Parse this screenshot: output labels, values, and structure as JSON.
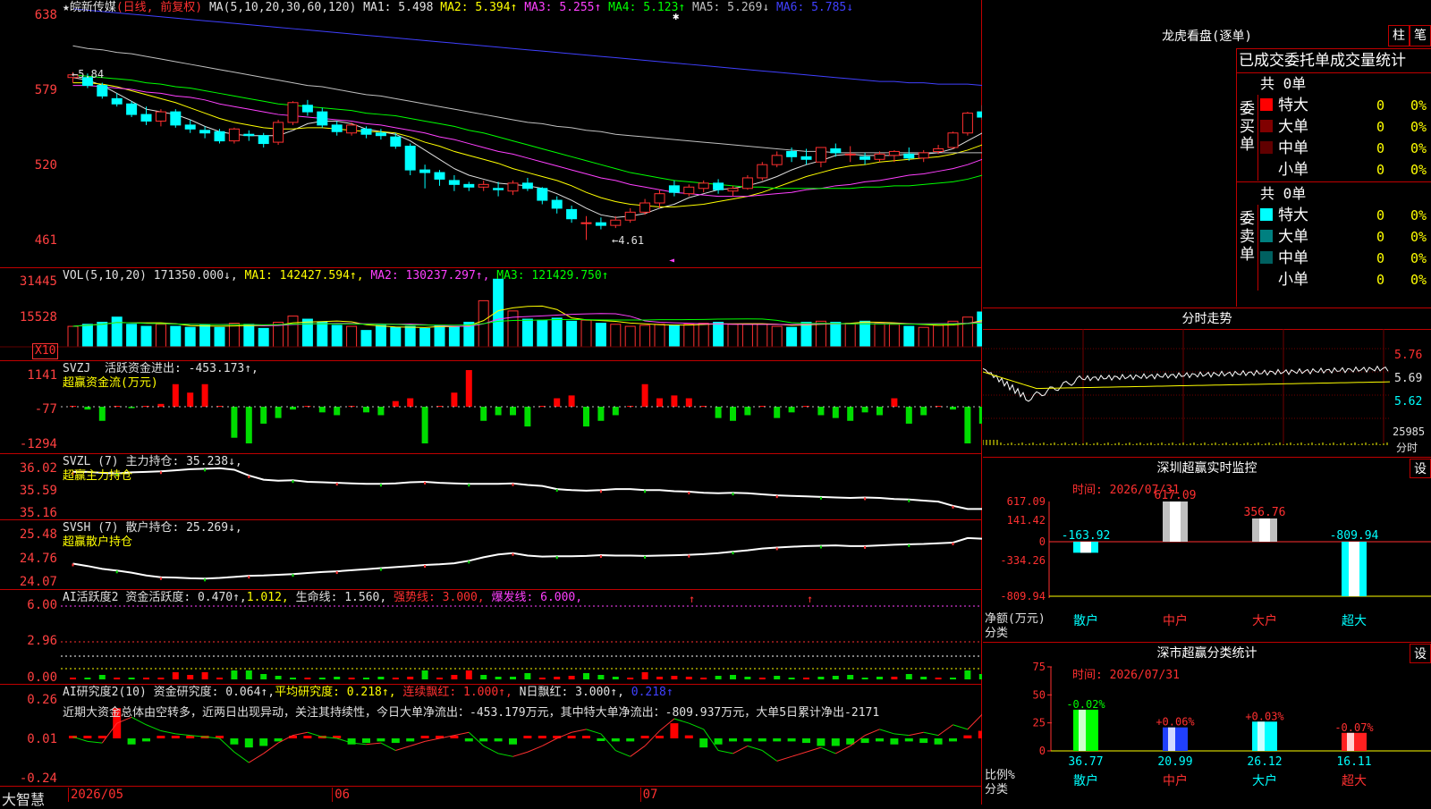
{
  "main": {
    "stock": "★皖新传媒",
    "period": "(日线, 前复权)",
    "ma_label": "MA(5,10,20,30,60,120)",
    "ma": [
      {
        "label": "MA1: 5.498",
        "color": "#e0e0e0"
      },
      {
        "label": "MA2: 5.394↑",
        "color": "#ffff00"
      },
      {
        "label": "MA3: 5.255↑",
        "color": "#ff40ff"
      },
      {
        "label": "MA4: 5.123↑",
        "color": "#00ff00"
      },
      {
        "label": "MA5: 5.269↓",
        "color": "#c0c0c0"
      },
      {
        "label": "MA6: 5.785↓",
        "color": "#4040ff"
      }
    ],
    "y_ticks": [
      "638",
      "579",
      "520",
      "461"
    ],
    "y_range": [
      4.45,
      6.4
    ],
    "high_label": "←5.84",
    "low_label": "←4.61",
    "candles": [
      [
        5.84,
        5.88,
        5.8,
        5.86
      ],
      [
        5.84,
        5.87,
        5.76,
        5.78
      ],
      [
        5.78,
        5.8,
        5.68,
        5.7
      ],
      [
        5.68,
        5.72,
        5.62,
        5.64
      ],
      [
        5.64,
        5.66,
        5.54,
        5.56
      ],
      [
        5.56,
        5.62,
        5.48,
        5.51
      ],
      [
        5.51,
        5.6,
        5.47,
        5.58
      ],
      [
        5.58,
        5.6,
        5.46,
        5.48
      ],
      [
        5.48,
        5.52,
        5.42,
        5.45
      ],
      [
        5.44,
        5.47,
        5.38,
        5.42
      ],
      [
        5.43,
        5.45,
        5.34,
        5.36
      ],
      [
        5.36,
        5.46,
        5.34,
        5.45
      ],
      [
        5.41,
        5.44,
        5.36,
        5.4
      ],
      [
        5.4,
        5.42,
        5.31,
        5.34
      ],
      [
        5.35,
        5.52,
        5.33,
        5.5
      ],
      [
        5.5,
        5.66,
        5.48,
        5.65
      ],
      [
        5.63,
        5.67,
        5.55,
        5.58
      ],
      [
        5.58,
        5.61,
        5.46,
        5.48
      ],
      [
        5.48,
        5.51,
        5.4,
        5.43
      ],
      [
        5.42,
        5.5,
        5.4,
        5.48
      ],
      [
        5.45,
        5.47,
        5.38,
        5.41
      ],
      [
        5.42,
        5.45,
        5.37,
        5.4
      ],
      [
        5.39,
        5.42,
        5.3,
        5.32
      ],
      [
        5.32,
        5.34,
        5.1,
        5.14
      ],
      [
        5.14,
        5.18,
        5.0,
        5.12
      ],
      [
        5.12,
        5.14,
        5.02,
        5.07
      ],
      [
        5.06,
        5.1,
        4.98,
        5.03
      ],
      [
        5.03,
        5.05,
        4.98,
        5.01
      ],
      [
        5.01,
        5.06,
        4.98,
        5.03
      ],
      [
        5.0,
        5.05,
        4.94,
        4.99
      ],
      [
        4.98,
        5.06,
        4.95,
        5.04
      ],
      [
        5.04,
        5.08,
        4.98,
        5.0
      ],
      [
        5.0,
        5.01,
        4.88,
        4.91
      ],
      [
        4.91,
        4.94,
        4.81,
        4.85
      ],
      [
        4.84,
        4.87,
        4.74,
        4.77
      ],
      [
        4.74,
        4.79,
        4.61,
        4.74
      ],
      [
        4.74,
        4.78,
        4.69,
        4.72
      ],
      [
        4.72,
        4.79,
        4.7,
        4.76
      ],
      [
        4.76,
        4.85,
        4.74,
        4.82
      ],
      [
        4.82,
        4.92,
        4.8,
        4.89
      ],
      [
        4.89,
        4.99,
        4.85,
        4.96
      ],
      [
        5.02,
        5.06,
        4.94,
        4.97
      ],
      [
        4.96,
        5.03,
        4.94,
        5.01
      ],
      [
        5.0,
        5.06,
        4.97,
        5.04
      ],
      [
        5.04,
        5.07,
        4.96,
        4.99
      ],
      [
        4.98,
        5.02,
        4.94,
        5.0
      ],
      [
        5.0,
        5.1,
        4.99,
        5.08
      ],
      [
        5.08,
        5.2,
        5.06,
        5.18
      ],
      [
        5.18,
        5.28,
        5.16,
        5.25
      ],
      [
        5.28,
        5.31,
        5.2,
        5.24
      ],
      [
        5.24,
        5.3,
        5.18,
        5.22
      ],
      [
        5.2,
        5.28,
        5.16,
        5.31
      ],
      [
        5.3,
        5.34,
        5.24,
        5.27
      ],
      [
        5.26,
        5.32,
        5.2,
        5.26
      ],
      [
        5.24,
        5.27,
        5.18,
        5.22
      ],
      [
        5.22,
        5.28,
        5.2,
        5.26
      ],
      [
        5.25,
        5.29,
        5.2,
        5.28
      ],
      [
        5.26,
        5.31,
        5.21,
        5.23
      ],
      [
        5.23,
        5.29,
        5.2,
        5.27
      ],
      [
        5.28,
        5.33,
        5.26,
        5.3
      ],
      [
        5.31,
        5.43,
        5.3,
        5.42
      ],
      [
        5.42,
        5.58,
        5.4,
        5.57
      ],
      [
        5.58,
        5.63,
        5.52,
        5.54
      ]
    ],
    "ma_lines": [
      {
        "color": "#e0e0e0",
        "v": [
          5.84,
          5.82,
          5.78,
          5.72,
          5.66,
          5.6,
          5.58,
          5.56,
          5.52,
          5.47,
          5.43,
          5.41,
          5.4,
          5.4,
          5.4,
          5.44,
          5.49,
          5.51,
          5.51,
          5.49,
          5.45,
          5.43,
          5.41,
          5.36,
          5.29,
          5.22,
          5.15,
          5.1,
          5.07,
          5.04,
          5.03,
          5.02,
          5.0,
          4.96,
          4.91,
          4.85,
          4.8,
          4.78,
          4.79,
          4.81,
          4.85,
          4.88,
          4.93,
          4.96,
          4.99,
          5.0,
          5.02,
          5.05,
          5.09,
          5.14,
          5.18,
          5.21,
          5.25,
          5.26,
          5.25,
          5.25,
          5.25,
          5.26,
          5.26,
          5.27,
          5.3,
          5.36,
          5.42
        ]
      },
      {
        "color": "#ffff00",
        "v": [
          5.8,
          5.8,
          5.79,
          5.77,
          5.74,
          5.71,
          5.68,
          5.65,
          5.61,
          5.57,
          5.53,
          5.5,
          5.48,
          5.46,
          5.45,
          5.45,
          5.46,
          5.46,
          5.45,
          5.44,
          5.43,
          5.43,
          5.42,
          5.39,
          5.35,
          5.32,
          5.28,
          5.25,
          5.22,
          5.19,
          5.15,
          5.12,
          5.09,
          5.06,
          5.02,
          4.97,
          4.93,
          4.9,
          4.88,
          4.87,
          4.86,
          4.86,
          4.87,
          4.88,
          4.9,
          4.92,
          4.94,
          4.97,
          5.01,
          5.05,
          5.09,
          5.12,
          5.15,
          5.17,
          5.18,
          5.2,
          5.21,
          5.22,
          5.23,
          5.24,
          5.26,
          5.29,
          5.33
        ]
      },
      {
        "color": "#ff40ff",
        "v": [
          5.78,
          5.78,
          5.77,
          5.76,
          5.75,
          5.73,
          5.72,
          5.7,
          5.69,
          5.67,
          5.64,
          5.62,
          5.6,
          5.58,
          5.56,
          5.55,
          5.54,
          5.53,
          5.52,
          5.51,
          5.49,
          5.48,
          5.46,
          5.44,
          5.42,
          5.39,
          5.37,
          5.34,
          5.31,
          5.28,
          5.26,
          5.23,
          5.2,
          5.17,
          5.14,
          5.11,
          5.08,
          5.06,
          5.03,
          5.01,
          4.99,
          4.97,
          4.96,
          4.95,
          4.94,
          4.94,
          4.94,
          4.95,
          4.96,
          4.97,
          4.99,
          5.0,
          5.02,
          5.03,
          5.05,
          5.06,
          5.08,
          5.1,
          5.11,
          5.13,
          5.15,
          5.18,
          5.22
        ]
      },
      {
        "color": "#00ff00",
        "v": [
          5.86,
          5.85,
          5.84,
          5.83,
          5.82,
          5.8,
          5.79,
          5.77,
          5.76,
          5.74,
          5.72,
          5.7,
          5.68,
          5.66,
          5.64,
          5.63,
          5.62,
          5.61,
          5.6,
          5.59,
          5.57,
          5.56,
          5.55,
          5.53,
          5.51,
          5.49,
          5.47,
          5.44,
          5.42,
          5.39,
          5.36,
          5.33,
          5.3,
          5.27,
          5.24,
          5.21,
          5.18,
          5.15,
          5.12,
          5.1,
          5.08,
          5.06,
          5.05,
          5.04,
          5.03,
          5.02,
          5.01,
          5.01,
          5.0,
          5.0,
          5.0,
          5.0,
          5.0,
          5.0,
          5.01,
          5.01,
          5.02,
          5.02,
          5.03,
          5.04,
          5.05,
          5.07,
          5.1
        ]
      },
      {
        "color": "#c0c0c0",
        "v": [
          6.08,
          6.06,
          6.05,
          6.03,
          6.02,
          6.0,
          5.98,
          5.96,
          5.94,
          5.92,
          5.9,
          5.88,
          5.86,
          5.84,
          5.82,
          5.8,
          5.78,
          5.77,
          5.75,
          5.73,
          5.71,
          5.7,
          5.68,
          5.66,
          5.64,
          5.62,
          5.6,
          5.58,
          5.56,
          5.54,
          5.52,
          5.5,
          5.49,
          5.47,
          5.46,
          5.44,
          5.43,
          5.41,
          5.4,
          5.39,
          5.38,
          5.37,
          5.36,
          5.35,
          5.34,
          5.33,
          5.32,
          5.31,
          5.3,
          5.29,
          5.28,
          5.28,
          5.27,
          5.27,
          5.27,
          5.27,
          5.27,
          5.27,
          5.27,
          5.27,
          5.27,
          5.27,
          5.27
        ]
      },
      {
        "color": "#4040ff",
        "v": [
          6.36,
          6.35,
          6.34,
          6.33,
          6.32,
          6.31,
          6.3,
          6.29,
          6.28,
          6.27,
          6.26,
          6.25,
          6.24,
          6.23,
          6.22,
          6.21,
          6.2,
          6.19,
          6.18,
          6.17,
          6.16,
          6.15,
          6.14,
          6.13,
          6.12,
          6.11,
          6.1,
          6.09,
          6.08,
          6.07,
          6.06,
          6.05,
          6.04,
          6.03,
          6.02,
          6.01,
          6.0,
          5.99,
          5.98,
          5.97,
          5.96,
          5.95,
          5.94,
          5.93,
          5.92,
          5.91,
          5.9,
          5.89,
          5.88,
          5.87,
          5.86,
          5.85,
          5.84,
          5.83,
          5.82,
          5.81,
          5.81,
          5.8,
          5.8,
          5.79,
          5.79,
          5.79,
          5.78
        ]
      }
    ]
  },
  "vol": {
    "title": "VOL(5,10,20)",
    "value": "171350.000↓,",
    "ma1": "MA1: 142427.594↑,",
    "ma2": "MA2: 130237.297↑,",
    "ma3": "MA3: 121429.750↑",
    "y_ticks": [
      "31445",
      "15528"
    ],
    "unit": "X10",
    "bars": [
      100,
      110,
      120,
      145,
      110,
      100,
      110,
      100,
      95,
      105,
      95,
      115,
      110,
      90,
      120,
      150,
      135,
      120,
      105,
      100,
      80,
      105,
      95,
      100,
      90,
      105,
      100,
      120,
      225,
      330,
      175,
      135,
      130,
      140,
      125,
      130,
      115,
      110,
      100,
      105,
      110,
      105,
      110,
      115,
      120,
      110,
      110,
      110,
      100,
      95,
      120,
      125,
      120,
      115,
      125,
      115,
      110,
      100,
      95,
      105,
      125,
      145,
      170
    ]
  },
  "svzj": {
    "title": "SVZJ",
    "line1": "活跃资金进出: -453.173↑,",
    "line2": "超赢资金流(万元)",
    "y_ticks": [
      "1141",
      "-77",
      "-1294"
    ],
    "bars": [
      0,
      -100,
      -500,
      0,
      -50,
      0,
      100,
      800,
      500,
      800,
      0,
      -1100,
      -1300,
      -600,
      -400,
      -100,
      0,
      -200,
      -300,
      0,
      -200,
      -300,
      200,
      300,
      -1300,
      0,
      500,
      1300,
      -500,
      -300,
      -300,
      -700,
      0,
      300,
      400,
      -700,
      -500,
      -300,
      0,
      800,
      300,
      400,
      300,
      0,
      -400,
      -500,
      -300,
      0,
      -400,
      -200,
      0,
      -300,
      -400,
      -500,
      -200,
      -300,
      300,
      -600,
      -300,
      0,
      -100,
      -1300,
      -600
    ]
  },
  "svzl": {
    "title": "SVZL (7)",
    "line1": "主力持仓: 35.238↓,",
    "line2": "超赢主力持仓",
    "y_ticks": [
      "36.02",
      "35.59",
      "35.16"
    ],
    "line": [
      35.95,
      35.95,
      35.93,
      35.92,
      35.94,
      35.95,
      35.96,
      35.98,
      36.0,
      36.01,
      36.02,
      35.99,
      35.88,
      35.8,
      35.78,
      35.79,
      35.76,
      35.75,
      35.74,
      35.73,
      35.72,
      35.72,
      35.73,
      35.75,
      35.76,
      35.74,
      35.73,
      35.72,
      35.72,
      35.72,
      35.73,
      35.7,
      35.68,
      35.62,
      35.6,
      35.59,
      35.6,
      35.62,
      35.62,
      35.6,
      35.6,
      35.58,
      35.57,
      35.55,
      35.54,
      35.55,
      35.54,
      35.52,
      35.5,
      35.49,
      35.48,
      35.47,
      35.46,
      35.45,
      35.46,
      35.45,
      35.43,
      35.42,
      35.4,
      35.38,
      35.3,
      35.24,
      35.24
    ]
  },
  "svsh": {
    "title": "SVSH (7)",
    "line1": "散户持仓: 25.269↓,",
    "line2": "超赢散户持仓",
    "y_ticks": [
      "25.48",
      "24.76",
      "24.07"
    ],
    "line": [
      24.62,
      24.55,
      24.47,
      24.42,
      24.36,
      24.28,
      24.23,
      24.22,
      24.2,
      24.19,
      24.21,
      24.24,
      24.27,
      24.28,
      24.3,
      24.32,
      24.35,
      24.38,
      24.4,
      24.43,
      24.46,
      24.49,
      24.52,
      24.55,
      24.58,
      24.6,
      24.63,
      24.7,
      24.8,
      24.88,
      24.92,
      24.85,
      24.82,
      24.83,
      24.83,
      24.84,
      24.86,
      24.85,
      24.85,
      24.84,
      24.85,
      24.86,
      24.87,
      24.89,
      24.92,
      24.96,
      25.0,
      25.05,
      25.08,
      25.1,
      25.12,
      25.13,
      25.14,
      25.12,
      25.12,
      25.14,
      25.16,
      25.17,
      25.18,
      25.2,
      25.22,
      25.35,
      25.33
    ]
  },
  "ai1": {
    "title": "AI活跃度2",
    "f1": "资金活跃度: 0.470↑,",
    "f2": "1.012,",
    "f3": "生命线: 1.560,",
    "f4": "强势线: 3.000,",
    "f5": "爆发线: 6.000,",
    "y_ticks": [
      "6.00",
      "2.96",
      "0.00"
    ]
  },
  "ai2": {
    "title": "AI研究度2(10)",
    "f1": "资金研究度: 0.064↑,",
    "f2": "平均研究度: 0.218↑,",
    "f3": "连续飘红: 1.000↑,",
    "f4": "N日飘红: 3.000↑,",
    "f5": "0.218↑",
    "comment": "近期大资金总体由空转多，近两日出现异动，关注其持续性，今日大单净流出：-453.179万元，其中特大单净流出：-809.937万元，大单5日累计净出-2171",
    "y_ticks": [
      "0.26",
      "0.01",
      "-0.24"
    ],
    "bars": [
      0.0,
      0.0,
      0.0,
      0.2,
      -0.04,
      -0.02,
      0.0,
      0.0,
      0.01,
      0.01,
      0.0,
      -0.04,
      -0.06,
      -0.05,
      -0.02,
      0.0,
      0.0,
      0.0,
      0.01,
      -0.04,
      -0.03,
      -0.02,
      -0.03,
      -0.02,
      0.0,
      0.0,
      0.0,
      -0.02,
      -0.02,
      -0.02,
      -0.04,
      0.0,
      0.0,
      0.01,
      0.0,
      0.0,
      -0.01,
      -0.02,
      -0.02,
      0.0,
      0.0,
      0.1,
      0.02,
      -0.06,
      -0.04,
      -0.02,
      -0.02,
      -0.02,
      -0.02,
      -0.02,
      -0.03,
      -0.05,
      -0.05,
      -0.04,
      -0.03,
      -0.02,
      -0.04,
      -0.02,
      -0.03,
      -0.04,
      -0.02,
      0.02,
      0.05
    ],
    "line": [
      0.01,
      -0.02,
      -0.03,
      0.1,
      0.14,
      0.09,
      0.05,
      0.03,
      0.02,
      0.01,
      0.0,
      -0.09,
      -0.16,
      -0.1,
      -0.03,
      0.02,
      0.04,
      0.01,
      0.0,
      -0.03,
      -0.04,
      -0.03,
      -0.08,
      -0.05,
      -0.02,
      0.0,
      0.02,
      0.04,
      -0.05,
      -0.1,
      -0.12,
      -0.09,
      -0.05,
      0.0,
      0.04,
      0.06,
      0.03,
      -0.08,
      -0.12,
      -0.05,
      0.05,
      0.13,
      0.1,
      0.06,
      -0.08,
      -0.1,
      -0.05,
      -0.08,
      -0.15,
      -0.12,
      -0.09,
      -0.06,
      -0.1,
      -0.05,
      0.02,
      0.06,
      0.03,
      0.02,
      0.04,
      0.02,
      0.09,
      0.06,
      0.16
    ]
  },
  "xaxis": {
    "brand": "大智慧",
    "labels": [
      {
        "t": "2026/05",
        "i": 0
      },
      {
        "t": "06",
        "i": 18
      },
      {
        "t": "07",
        "i": 39
      }
    ]
  },
  "longhu": {
    "title": "龙虎看盘(逐单)",
    "btn1": "柱",
    "btn2": "笔",
    "header": "已成交委托单成交量统计",
    "buy_label": "委买单",
    "sell_label": "委卖单",
    "buy_total": "共 0单",
    "sell_total": "共 0单",
    "rows": [
      "特大",
      "大单",
      "中单",
      "小单"
    ],
    "val": "0",
    "pct": "0%",
    "buy_colors": [
      "#ff0000",
      "#800000",
      "#600000",
      "#000000"
    ],
    "sell_colors": [
      "#00ffff",
      "#008080",
      "#006060",
      "#000000"
    ]
  },
  "fenshi": {
    "title": "分时走势",
    "prices": [
      "5.76",
      "5.69",
      "5.62"
    ],
    "vol": "25985",
    "unit": "分时"
  },
  "szmon": {
    "title": "深圳超赢实时监控",
    "btn": "设",
    "time": "时间: 2026/07/31",
    "y_ticks": [
      "617.09",
      "141.42",
      "0",
      "-334.26",
      "-809.94"
    ],
    "ylabel": "净额(万元)",
    "xlabel": "分类",
    "cats": [
      "散户",
      "中户",
      "大户",
      "超大"
    ],
    "values": [
      -163.92,
      617.09,
      356.76,
      -809.94
    ],
    "labels": [
      "-163.92",
      "617.09",
      "356.76",
      "-809.94"
    ]
  },
  "szstat": {
    "title": "深市超赢分类统计",
    "btn": "设",
    "time": "时间: 2026/07/31",
    "y_ticks": [
      "75",
      "50",
      "25",
      "0"
    ],
    "ylabel": "比例%",
    "xlabel": "分类",
    "cats": [
      "散户",
      "中户",
      "大户",
      "超大"
    ],
    "values": [
      36.77,
      20.99,
      26.12,
      16.11
    ],
    "labels": [
      "36.77",
      "20.99",
      "26.12",
      "16.11"
    ],
    "deltas": [
      "-0.02%",
      "+0.06%",
      "+0.03%",
      "-0.07%"
    ],
    "colors": [
      "#00ff00",
      "#2040ff",
      "#00ffff",
      "#ff2020"
    ]
  }
}
